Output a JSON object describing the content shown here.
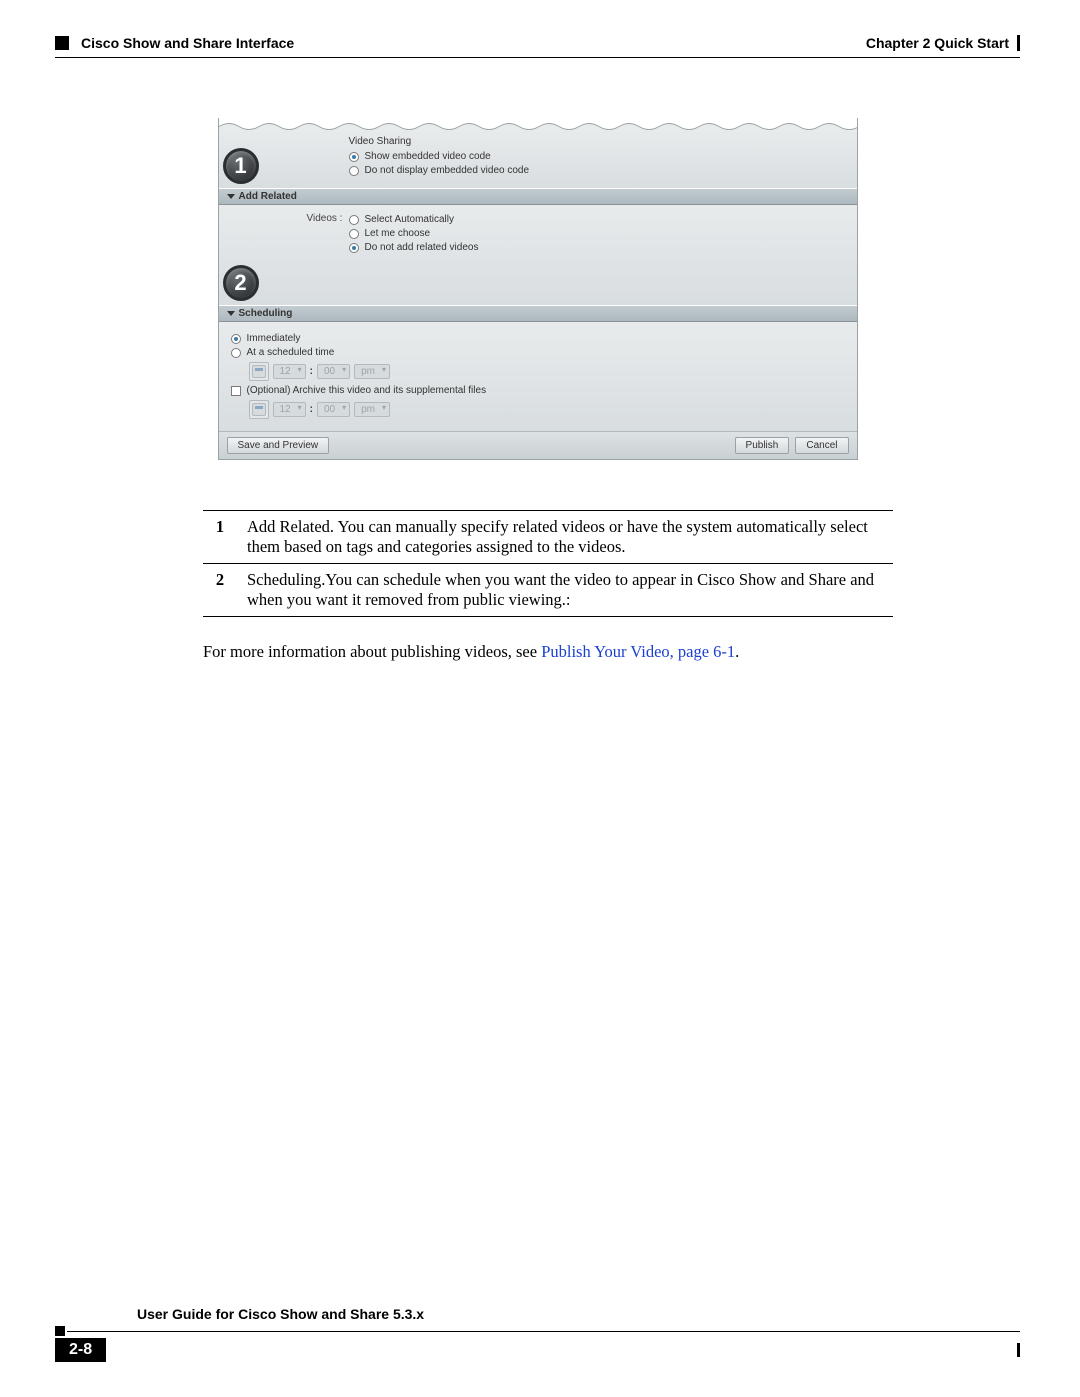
{
  "header": {
    "section": "Cisco Show and Share Interface",
    "chapter": "Chapter 2      Quick Start"
  },
  "panel": {
    "videoSharing": {
      "title": "Video Sharing",
      "opt1": "Show embedded video code",
      "opt2": "Do not display embedded video code"
    },
    "addRelated": {
      "header": "Add Related",
      "label": "Videos :",
      "opt1": "Select Automatically",
      "opt2": "Let me choose",
      "opt3": "Do not add related videos"
    },
    "scheduling": {
      "header": "Scheduling",
      "opt1": "Immediately",
      "opt2": "At a scheduled time",
      "hour": "12",
      "min": "00",
      "ampm": "pm",
      "archive": "(Optional) Archive this video and its supplemental files"
    },
    "buttons": {
      "save": "Save and Preview",
      "publish": "Publish",
      "cancel": "Cancel"
    },
    "callout1": "1",
    "callout2": "2"
  },
  "table": {
    "r1n": "1",
    "r1t": "Add Related. You can manually specify related videos or have the system automatically select them based on tags and categories assigned to the videos.",
    "r2n": "2",
    "r2t": "Scheduling.You can schedule when you want the video to appear in Cisco Show and Share and when you want it removed from public viewing.:"
  },
  "para": {
    "text": "For more information about publishing videos, see ",
    "link": "Publish Your Video, page 6-1",
    "end": "."
  },
  "footer": {
    "title": "User Guide for Cisco Show and Share 5.3.x",
    "page": "2-8"
  }
}
